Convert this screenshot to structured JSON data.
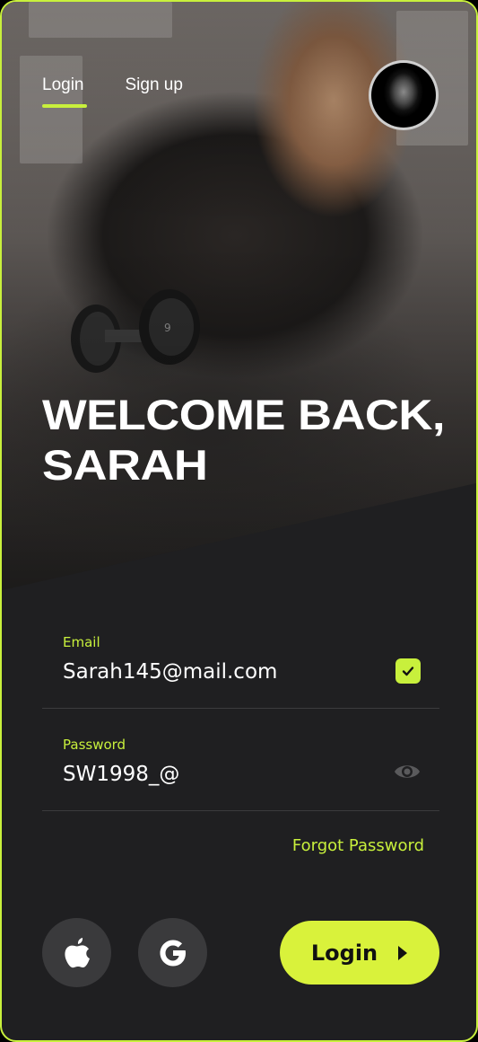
{
  "tabs": [
    {
      "label": "Login",
      "active": true
    },
    {
      "label": "Sign up",
      "active": false
    }
  ],
  "avatar": {
    "icon": "user-avatar"
  },
  "welcome": {
    "line1": "WELCOME BACK,",
    "line2": "SARAH"
  },
  "email": {
    "label": "Email",
    "value": "Sarah145@mail.com",
    "status_icon": "check-icon"
  },
  "password": {
    "label": "Password",
    "value": "SW1998_@",
    "toggle_icon": "eye-icon"
  },
  "forgot_password": "Forgot Password",
  "social": [
    {
      "name": "apple",
      "icon": "apple-icon"
    },
    {
      "name": "google",
      "icon": "google-icon"
    }
  ],
  "login_button": {
    "label": "Login",
    "icon": "chevron-right-icon"
  },
  "colors": {
    "accent": "#c8f03c",
    "background": "#1f1f21",
    "button": "#d9f23b",
    "social_bg": "#3a3a3c"
  }
}
